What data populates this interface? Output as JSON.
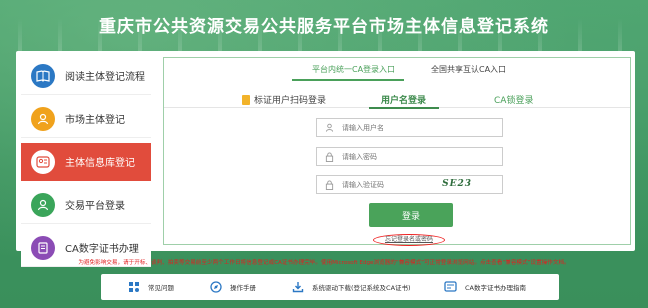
{
  "header": {
    "title": "重庆市公共资源交易公共服务平台市场主体信息登记系统"
  },
  "sidebar": {
    "items": [
      {
        "label": "阅读主体登记流程",
        "icon": "book-icon",
        "color": "#2b78c4",
        "active": false
      },
      {
        "label": "市场主体登记",
        "icon": "person-icon",
        "color": "#f0a21c",
        "active": false
      },
      {
        "label": "主体信息库登记",
        "icon": "id-card-icon",
        "color": "#e14c3c",
        "active": true
      },
      {
        "label": "交易平台登录",
        "icon": "user-icon",
        "color": "#3aa55a",
        "active": false
      },
      {
        "label": "CA数字证书办理",
        "icon": "certificate-icon",
        "color": "#8b4cb5",
        "active": false
      }
    ]
  },
  "login": {
    "top_tabs": [
      "平台内统一CA登录入口",
      "全国共享互认CA入口"
    ],
    "methods": [
      "标证用户扫码登录",
      "用户名登录",
      "CA锁登录"
    ],
    "fields": {
      "username_placeholder": "请输入用户名",
      "password_placeholder": "请输入密码",
      "captcha_placeholder": "请输入验证码",
      "captcha_text": "SE23"
    },
    "login_button": "登录",
    "forgot_link": "忘记登录名或密码"
  },
  "notice": "为避免影响交易，请于开标、谈判、拍卖等交易前至少两个工作日将信息登记或CA证书办理完毕。使用Microsoft Edge浏览器的“兼容模式”可正常登录浏览网站。点击查看“兼容模式”设置操作文档。",
  "footer": {
    "items": [
      {
        "label": "常见问题",
        "icon": "grid-icon"
      },
      {
        "label": "操作手册",
        "icon": "compass-icon"
      },
      {
        "label": "系统驱动下载(登记系统及CA证书)",
        "icon": "download-icon"
      },
      {
        "label": "CA数字证书办理指南",
        "icon": "card-icon"
      }
    ]
  },
  "colors": {
    "brand_green": "#4aa35a",
    "alert_red": "#e02020",
    "active_red": "#e14c3c"
  }
}
